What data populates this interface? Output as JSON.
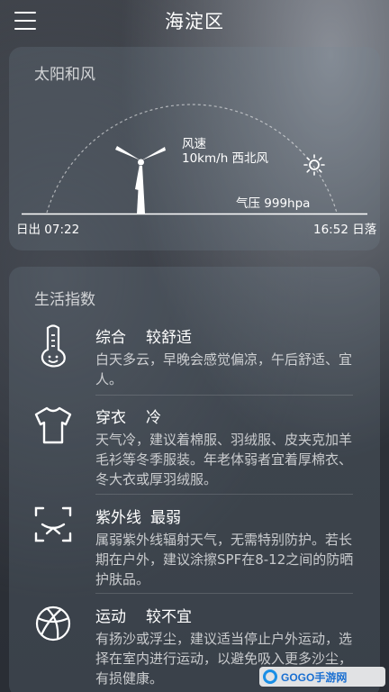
{
  "header": {
    "title": "海淀区",
    "menu_icon": "menu-icon"
  },
  "sun_wind": {
    "section_title": "太阳和风",
    "wind_label": "风速",
    "wind_value": "10km/h 西北风",
    "pressure": "气压 999hpa",
    "sunrise": "日出 07:22",
    "sunset": "16:52 日落",
    "icons": [
      "windmill-icon",
      "sun-icon"
    ]
  },
  "life_index": {
    "section_title": "生活指数",
    "items": [
      {
        "name": "综合",
        "level": "较舒适",
        "desc": "白天多云，早晚会感觉偏凉，午后舒适、宜人。",
        "icon": "thermometer-icon"
      },
      {
        "name": "穿衣",
        "level": "冷",
        "desc": "天气冷，建议着棉服、羽绒服、皮夹克加羊毛衫等冬季服装。年老体弱者宜着厚棉衣、冬大衣或厚羽绒服。",
        "icon": "tshirt-icon"
      },
      {
        "name": "紫外线",
        "level": "最弱",
        "desc": "属弱紫外线辐射天气，无需特别防护。若长期在户外，建议涂擦SPF在8-12之间的防晒护肤品。",
        "icon": "uv-icon"
      },
      {
        "name": "运动",
        "level": "较不宜",
        "desc": "有扬沙或浮尘，建议适当停止户外运动，选择在室内进行运动，以避免吸入更多沙尘，有损健康。",
        "icon": "basketball-icon"
      }
    ]
  },
  "watermark": {
    "text": "GOGO手游网"
  }
}
